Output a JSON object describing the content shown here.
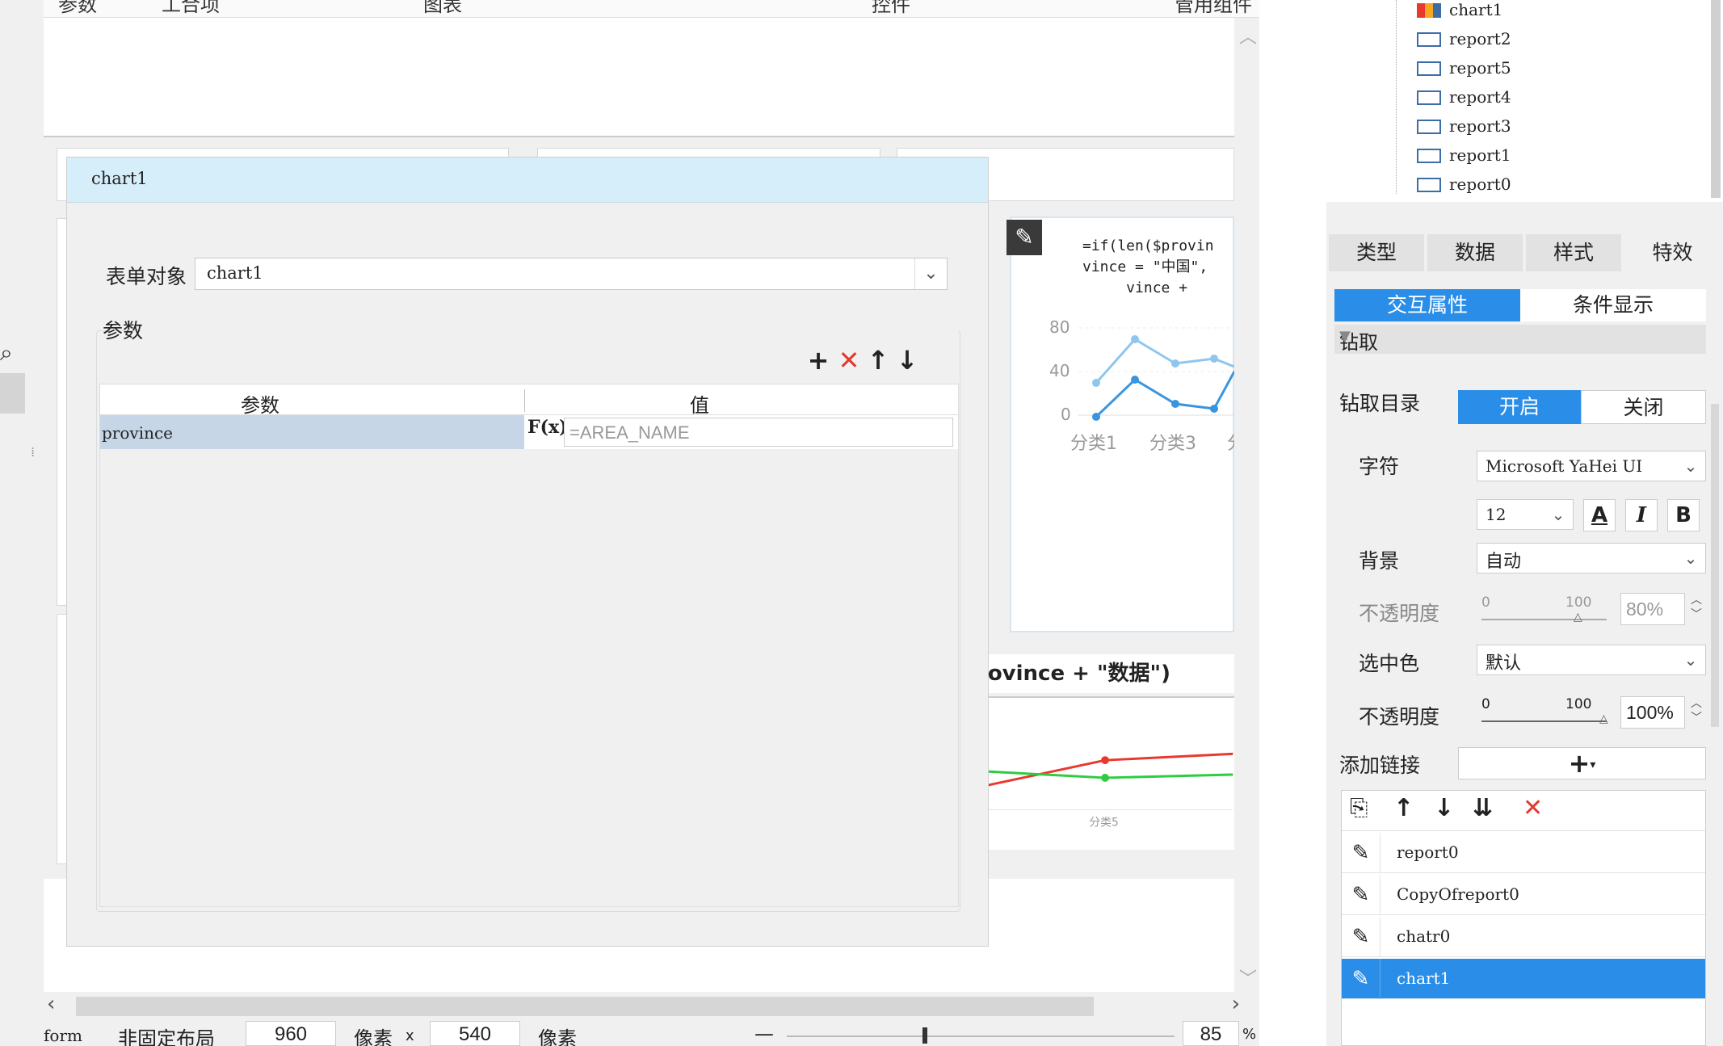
{
  "topbar": {
    "items": [
      "参数",
      "工合项",
      "图表",
      "控件",
      "管用组件"
    ]
  },
  "canvas": {
    "formula_text": "=if(len($provin\nvince = \"中国\",\n     vince +",
    "formula_bottom": "rovince + \"数据\")",
    "mini_chart": {
      "y_ticks": [
        "80",
        "40",
        "0"
      ],
      "x_labels": [
        "分类1",
        "分类3",
        "分"
      ],
      "series_colors": [
        "#8ec6ee",
        "#3a95e0"
      ]
    },
    "bottom_chart": {
      "x_label": "分类5",
      "series_colors": [
        "#e8392e",
        "#2ecc40"
      ]
    }
  },
  "dialog": {
    "title": "chart1",
    "form_object_label": "表单对象",
    "form_object_value": "chart1",
    "params_label": "参数",
    "table": {
      "col_param": "参数",
      "col_value": "值",
      "rows": [
        {
          "param": "province",
          "fx": "F(x)",
          "value_placeholder": "=AREA_NAME"
        }
      ]
    }
  },
  "statusbar": {
    "form_label": "form",
    "layout": "非固定布局",
    "width": "960",
    "unit1": "像素",
    "x": "x",
    "height": "540",
    "unit2": "像素",
    "zoom_minus": "—",
    "zoom_plus": "+",
    "zoom_value": "85",
    "zoom_unit": "%"
  },
  "tree": {
    "items": [
      "chart1",
      "report2",
      "report5",
      "report4",
      "report3",
      "report1",
      "report0"
    ]
  },
  "right_tabs": [
    "类型",
    "数据",
    "样式",
    "特效"
  ],
  "sub_tabs": [
    "交互属性",
    "条件显示"
  ],
  "drill": {
    "header": "钻取",
    "dir_label": "钻取目录",
    "on": "开启",
    "off": "关闭",
    "font_label": "字符",
    "font_value": "Microsoft YaHei UI",
    "size_value": "12",
    "bg_label": "背景",
    "bg_value": "自动",
    "opacity_label_1": "不透明度",
    "opacity_1_min": "0",
    "opacity_1_max": "100",
    "opacity_1_value": "80%",
    "sel_color_label": "选中色",
    "sel_color_value": "默认",
    "opacity_label_2": "不透明度",
    "opacity_2_min": "0",
    "opacity_2_max": "100",
    "opacity_2_value": "100%",
    "add_link_label": "添加链接"
  },
  "links": [
    "report0",
    "CopyOfreport0",
    "chatr0",
    "chart1"
  ],
  "colors": {
    "accent": "#2a8ee8",
    "delete": "#e23a2e",
    "dialog_title_bg": "#d6eefa"
  }
}
